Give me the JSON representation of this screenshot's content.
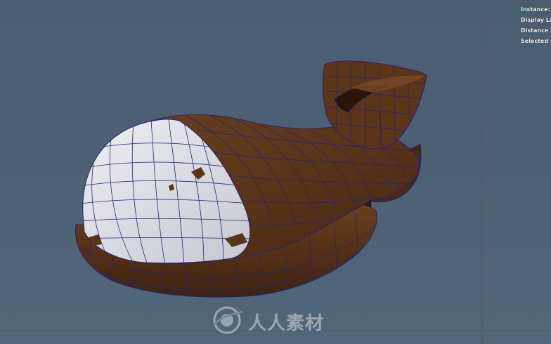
{
  "hud": {
    "lines": [
      "Instance:",
      "Display Lay",
      "Distance Fr",
      "Selected O"
    ]
  },
  "watermark": {
    "text": "人人素材"
  },
  "colors": {
    "background": "#4e6073",
    "grid_line": "#2f6b4e",
    "mesh_brown": "#5a3418",
    "mesh_brown_dark": "#3e2110",
    "mesh_white": "#e4e4ea",
    "wireframe": "#23237a"
  }
}
